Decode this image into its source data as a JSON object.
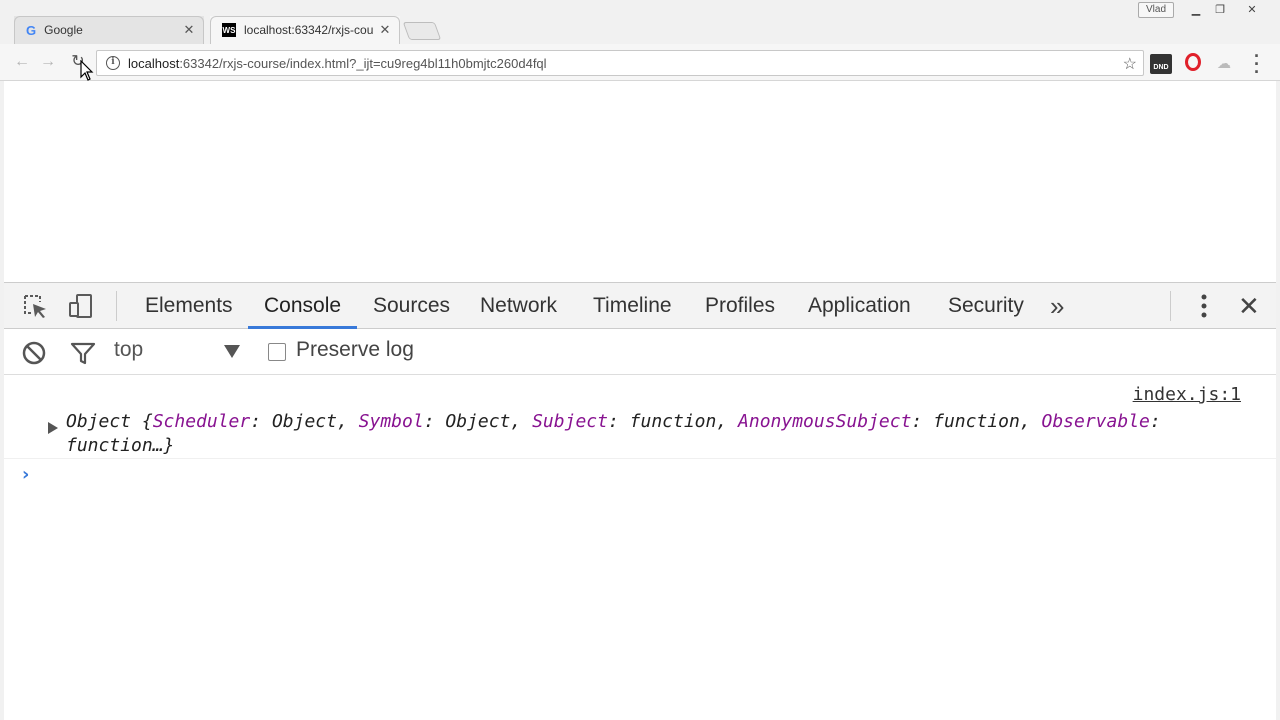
{
  "browser": {
    "tabs": [
      {
        "title": "Google",
        "favicon": "google-icon",
        "active": false
      },
      {
        "title": "localhost:63342/rxjs-cou",
        "favicon": "webstorm-icon",
        "active": true
      }
    ],
    "user_badge": "Vlad",
    "address": {
      "host": "localhost",
      "path": ":63342/rxjs-course/index.html?_ijt=cu9reg4bl11h0bmjtc260d4fql"
    },
    "extensions": {
      "dnd_label": "DND"
    }
  },
  "devtools": {
    "tabs": [
      "Elements",
      "Console",
      "Sources",
      "Network",
      "Timeline",
      "Profiles",
      "Application",
      "Security"
    ],
    "active_tab": "Console",
    "filter": {
      "context": "top",
      "preserve_log_label": "Preserve log",
      "preserve_log_checked": false
    },
    "console": {
      "source_link": "index.js:1",
      "log": {
        "prefix": "Object {",
        "entries": [
          {
            "key": "Scheduler",
            "value": "Object"
          },
          {
            "key": "Symbol",
            "value": "Object"
          },
          {
            "key": "Subject",
            "value": "function"
          },
          {
            "key": "AnonymousSubject",
            "value": "function"
          },
          {
            "key": "Observable",
            "value": "function…}"
          }
        ]
      },
      "prompt": "›"
    }
  },
  "colors": {
    "accent": "#3879d9",
    "property_key": "#881391",
    "opera_red": "#e0202a"
  }
}
